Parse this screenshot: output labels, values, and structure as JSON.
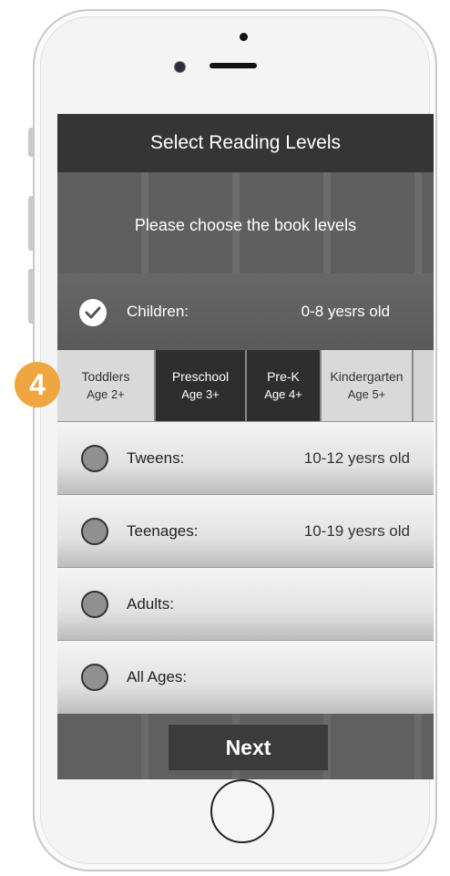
{
  "header": {
    "title": "Select Reading Levels"
  },
  "banner": {
    "prompt": "Please choose the book levels"
  },
  "children": {
    "label": "Children:",
    "age": "0-8 yesrs old",
    "checked": true
  },
  "tabs": [
    {
      "name": "Toddlers",
      "age": "Age 2+",
      "selected": false
    },
    {
      "name": "Preschool",
      "age": "Age 3+",
      "selected": true
    },
    {
      "name": "Pre-K",
      "age": "Age 4+",
      "selected": true
    },
    {
      "name": "Kindergarten",
      "age": "Age 5+",
      "selected": false
    }
  ],
  "options": [
    {
      "label": "Tweens:",
      "age": "10-12 yesrs old"
    },
    {
      "label": "Teenages:",
      "age": "10-19 yesrs old"
    },
    {
      "label": "Adults:",
      "age": ""
    },
    {
      "label": "All Ages:",
      "age": ""
    }
  ],
  "next_label": "Next",
  "step_badge": "4",
  "colors": {
    "badge": "#f0a640",
    "header": "#353535",
    "tab_selected": "#2e2e2e"
  },
  "icons": {
    "check": "check-icon",
    "radio": "radio-icon",
    "camera": "camera-icon"
  }
}
